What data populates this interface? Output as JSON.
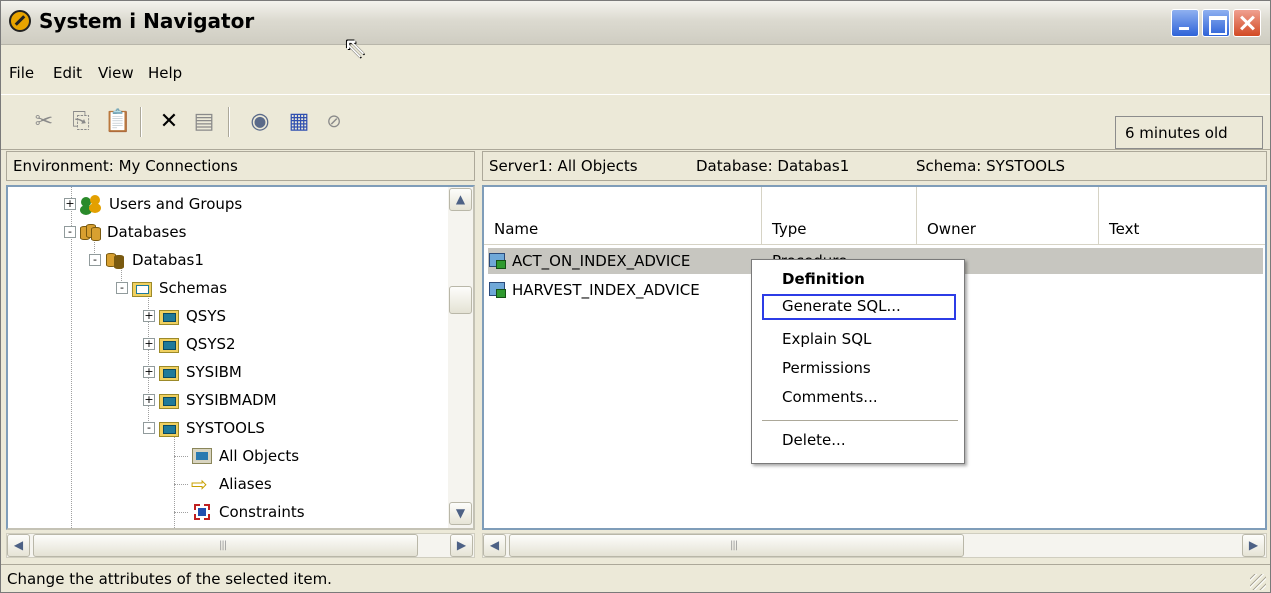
{
  "window": {
    "title": "System i Navigator"
  },
  "menubar": {
    "items": [
      "File",
      "Edit",
      "View",
      "Help"
    ]
  },
  "toolbar": {
    "icons": [
      "cut-icon",
      "copy-icon",
      "paste-icon",
      "delete-icon",
      "properties-icon",
      "refresh-icon",
      "run-sql-icon",
      "stop-icon"
    ],
    "age_status": "6 minutes old"
  },
  "left_pane": {
    "header": "Environment: My Connections",
    "tree": [
      {
        "label": "Users and Groups",
        "level": 0,
        "expander": "+",
        "icon": "users-groups-icon"
      },
      {
        "label": "Databases",
        "level": 0,
        "expander": "-",
        "icon": "databases-icon"
      },
      {
        "label": "Databas1",
        "level": 1,
        "expander": "-",
        "icon": "database-icon"
      },
      {
        "label": "Schemas",
        "level": 2,
        "expander": "-",
        "icon": "schemas-folder-icon"
      },
      {
        "label": "QSYS",
        "level": 3,
        "expander": "+",
        "icon": "schema-icon"
      },
      {
        "label": "QSYS2",
        "level": 3,
        "expander": "+",
        "icon": "schema-icon"
      },
      {
        "label": "SYSIBM",
        "level": 3,
        "expander": "+",
        "icon": "schema-icon"
      },
      {
        "label": "SYSIBMADM",
        "level": 3,
        "expander": "+",
        "icon": "schema-icon"
      },
      {
        "label": "SYSTOOLS",
        "level": 3,
        "expander": "-",
        "icon": "schema-icon"
      },
      {
        "label": "All Objects",
        "level": 4,
        "expander": "",
        "icon": "all-objects-icon"
      },
      {
        "label": "Aliases",
        "level": 4,
        "expander": "",
        "icon": "aliases-icon"
      },
      {
        "label": "Constraints",
        "level": 4,
        "expander": "",
        "icon": "constraints-icon"
      }
    ]
  },
  "right_pane": {
    "header": {
      "server": "Server1:  All Objects",
      "database": "Database: Databas1",
      "schema": "Schema: SYSTOOLS"
    },
    "columns": [
      "Name",
      "Type",
      "Owner",
      "Text"
    ],
    "rows": [
      {
        "name": "ACT_ON_INDEX_ADVICE",
        "type": "Procedure",
        "selected": true
      },
      {
        "name": "HARVEST_INDEX_ADVICE",
        "type": "",
        "selected": false
      }
    ]
  },
  "context_menu": {
    "items": [
      "Definition",
      "Generate SQL...",
      "Explain SQL",
      "Permissions",
      "Comments...",
      "Delete..."
    ],
    "default_item": "Definition",
    "focused_item": "Generate SQL..."
  },
  "statusbar": {
    "text": "Change the attributes of the selected item."
  },
  "colors": {
    "window_bg": "#ece9d8",
    "selection": "#c7c6c0",
    "focus_outline": "#2c3ce6",
    "pane_border": "#7f9db9"
  }
}
